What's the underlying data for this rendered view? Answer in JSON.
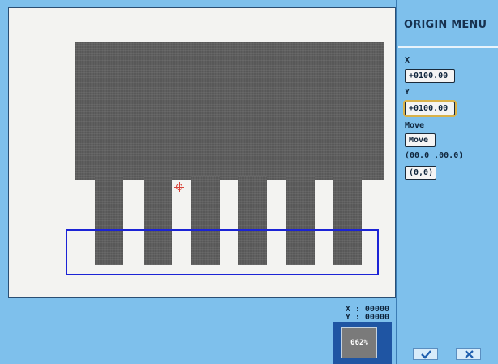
{
  "panel": {
    "title": "ORIGIN  MENU",
    "x_label": "X",
    "x_value": "+0100.00",
    "y_label": "Y",
    "y_value": "+0100.00",
    "move_label": "Move",
    "move_button": "Move",
    "coord_label": "(00.0 ,00.0)",
    "origin_button": "(0,0)"
  },
  "readout": {
    "x": "X : 00000",
    "y": "Y : 00000"
  },
  "zoom": "062%",
  "icons": {
    "confirm": "checkmark-icon",
    "cancel": "close-icon",
    "target": "crosshair-icon"
  },
  "colors": {
    "background": "#7ec0ec",
    "selection": "#1b23d6",
    "crosshair": "#d8443a",
    "zoom_frame": "#1f55a3"
  }
}
